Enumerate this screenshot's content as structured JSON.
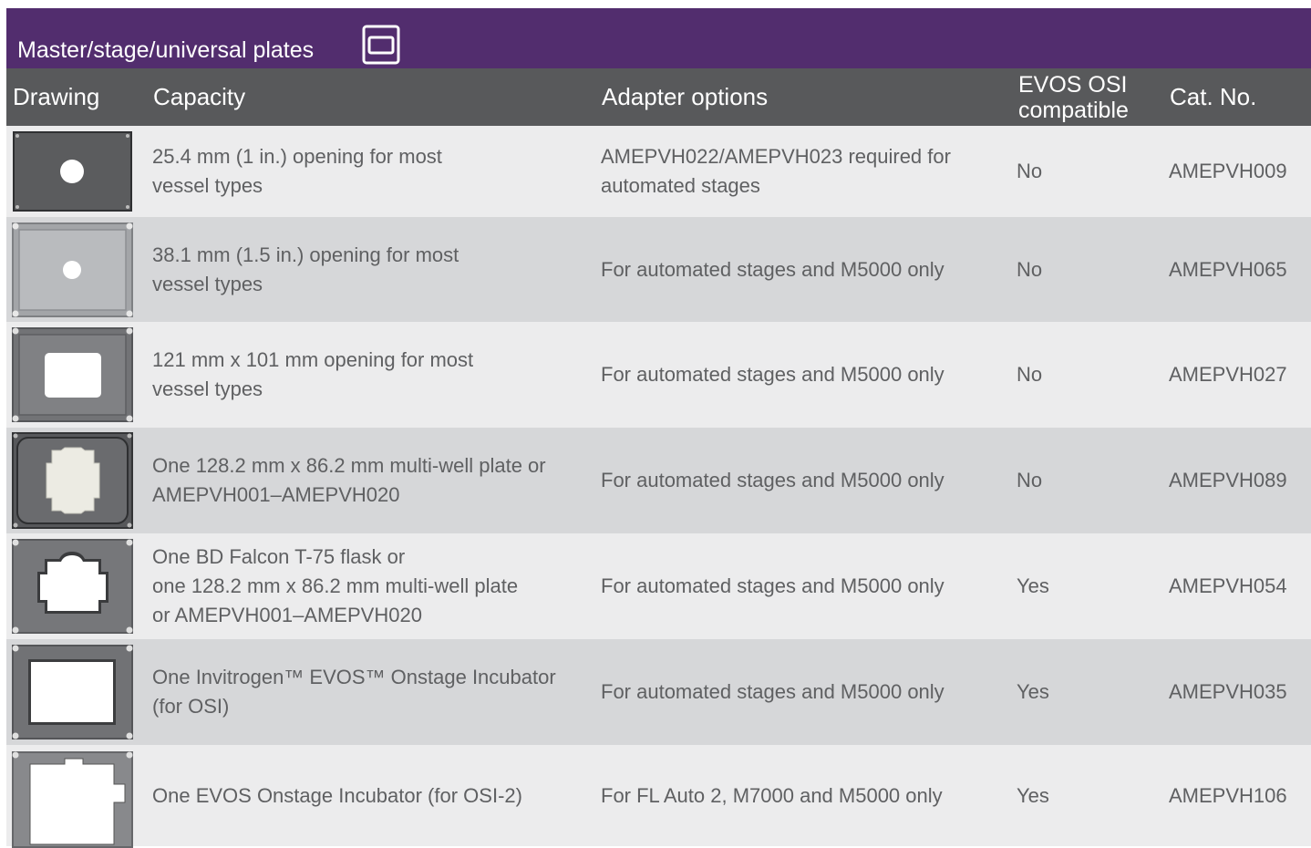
{
  "banner": {
    "title": "Master/stage/universal plates",
    "icon": "plate-outline-icon"
  },
  "headers": {
    "drawing": "Drawing",
    "capacity": "Capacity",
    "adapter": "Adapter options",
    "osi_line1": "EVOS OSI",
    "osi_line2": "compatible",
    "cat": "Cat. No."
  },
  "rows": [
    {
      "drawing_icon": "plate-round-opening-small-icon",
      "capacity": [
        "25.4 mm (1 in.) opening for most",
        "vessel types"
      ],
      "adapter": [
        "AMEPVH022/AMEPVH023 required for",
        "automated stages"
      ],
      "osi": "No",
      "cat": "AMEPVH009"
    },
    {
      "drawing_icon": "plate-round-opening-large-icon",
      "capacity": [
        "38.1 mm (1.5 in.) opening for most",
        "vessel types"
      ],
      "adapter": [
        "For automated stages and M5000 only"
      ],
      "osi": "No",
      "cat": "AMEPVH065"
    },
    {
      "drawing_icon": "plate-rectangular-opening-icon",
      "capacity": [
        "121 mm x 101 mm opening for most",
        "vessel types"
      ],
      "adapter": [
        "For automated stages and M5000 only"
      ],
      "osi": "No",
      "cat": "AMEPVH027"
    },
    {
      "drawing_icon": "plate-multiwell-opening-icon",
      "capacity": [
        "One 128.2 mm x 86.2 mm multi-well plate or",
        "AMEPVH001–AMEPVH020"
      ],
      "adapter": [
        "For automated stages and M5000 only"
      ],
      "osi": "No",
      "cat": "AMEPVH089"
    },
    {
      "drawing_icon": "plate-flask-opening-icon",
      "capacity": [
        "One BD Falcon T-75 flask or",
        "one 128.2 mm x 86.2 mm multi-well plate",
        "or AMEPVH001–AMEPVH020"
      ],
      "adapter": [
        "For automated stages and M5000 only"
      ],
      "osi": "Yes",
      "cat": "AMEPVH054"
    },
    {
      "drawing_icon": "plate-osi-opening-icon",
      "capacity": [
        "One Invitrogen™ EVOS™ Onstage Incubator",
        "(for OSI)"
      ],
      "adapter": [
        "For automated stages and M5000 only"
      ],
      "osi": "Yes",
      "cat": "AMEPVH035"
    },
    {
      "drawing_icon": "plate-osi2-opening-icon",
      "capacity": [
        "One EVOS Onstage Incubator (for OSI-2)"
      ],
      "adapter": [
        "For FL Auto 2, M7000 and M5000 only"
      ],
      "osi": "Yes",
      "cat": "AMEPVH106"
    }
  ]
}
